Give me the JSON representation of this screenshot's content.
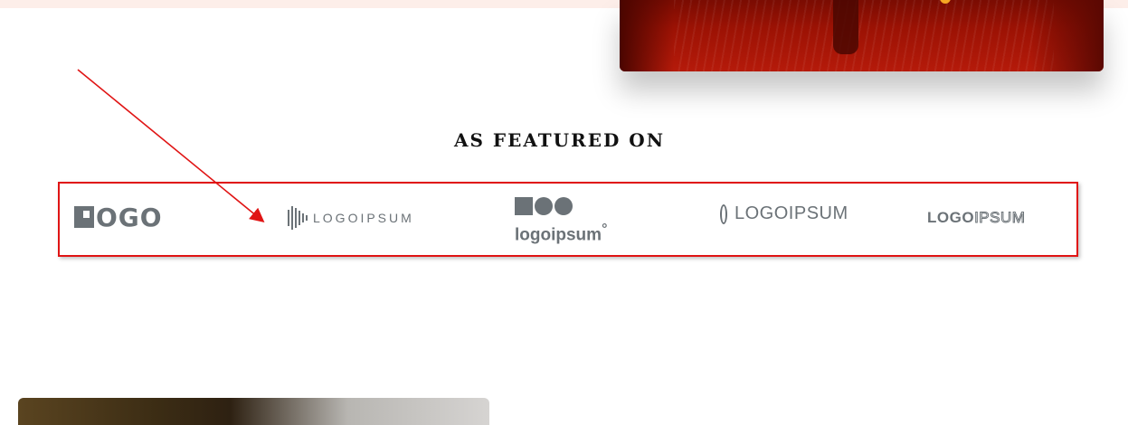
{
  "featured": {
    "heading": "AS FEATURED ON"
  },
  "logos": {
    "logo1": "OGO",
    "logo2": "LOGOIPSUM",
    "logo3": "logoipsum",
    "logo3_mark": "°",
    "logo4": "LOGOIPSUM",
    "logo5_bold": "LOGO",
    "logo5_outline": "IPSUM"
  },
  "colors": {
    "annotation": "#e01414",
    "logo_gray": "#6b7277",
    "hero_red": "#9c1204",
    "top_strip": "#fdeee9"
  }
}
